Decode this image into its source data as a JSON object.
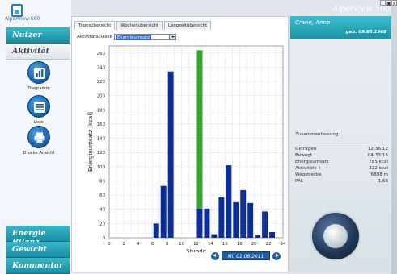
{
  "app": {
    "title": "AlperView 500",
    "logo_text": "AlperView 500",
    "window_controls": [
      "_",
      "▣",
      "x"
    ]
  },
  "sidebar": {
    "nav_top": [
      {
        "label": "Nutzer"
      },
      {
        "label": "Aktivität"
      }
    ],
    "items": [
      {
        "label": "Diagramm",
        "icon": "bar-chart-icon"
      },
      {
        "label": "Liste",
        "icon": "list-icon"
      },
      {
        "label": "Drucke Ansicht",
        "icon": "printer-icon"
      }
    ],
    "nav_bottom": [
      {
        "label": "Energie Bilanz"
      },
      {
        "label": "Gewicht"
      },
      {
        "label": "Kommentar"
      }
    ]
  },
  "main": {
    "tabs": [
      {
        "label": "Tagesübersicht",
        "active": true
      },
      {
        "label": "Wochenübersicht",
        "active": false
      },
      {
        "label": "Langzeitübersicht",
        "active": false
      }
    ],
    "class_label": "Aktivitätsklasse",
    "class_value": "Energieumsatz",
    "date": "Mi, 01.06.2011"
  },
  "user": {
    "name": "Crane, Anne",
    "birth": "geb. 09.05.1968"
  },
  "summary": {
    "title": "Zusammenfassung",
    "rows": [
      {
        "label": "Getragen",
        "value": "12:36:12"
      },
      {
        "label": "Bewegt",
        "value": "04:33:16"
      },
      {
        "label": "Energieumsatz",
        "value": "785 kcal"
      },
      {
        "label": "Aktivität++",
        "value": "222 kcal"
      },
      {
        "label": "Wegstrecke",
        "value": "6898 m"
      },
      {
        "label": "PAL",
        "value": "1,68"
      }
    ]
  },
  "colors": {
    "bar": "#0b2f96",
    "highlight": "#3aa12e",
    "accent": "#1a93a7"
  },
  "chart_data": {
    "type": "bar",
    "xlabel": "Stunde",
    "ylabel": "Energieumsatz [kcal]",
    "xlim": [
      0,
      24
    ],
    "ylim": [
      0,
      270
    ],
    "xticks": [
      0,
      2,
      4,
      6,
      8,
      10,
      12,
      14,
      16,
      18,
      20,
      22,
      24
    ],
    "yticks": [
      0,
      20,
      40,
      60,
      80,
      100,
      120,
      140,
      160,
      180,
      200,
      220,
      240,
      260
    ],
    "grid": true,
    "bars": [
      {
        "x": 6.5,
        "value": 20
      },
      {
        "x": 7.5,
        "value": 73
      },
      {
        "x": 8.5,
        "value": 234
      },
      {
        "x": 12.5,
        "value": 41,
        "highlight_total": 264
      },
      {
        "x": 13.5,
        "value": 41
      },
      {
        "x": 14.5,
        "value": 5
      },
      {
        "x": 15.5,
        "value": 57
      },
      {
        "x": 16.5,
        "value": 102
      },
      {
        "x": 17.5,
        "value": 50
      },
      {
        "x": 18.5,
        "value": 67
      },
      {
        "x": 19.5,
        "value": 49
      },
      {
        "x": 20.5,
        "value": 4
      },
      {
        "x": 21.5,
        "value": 37
      },
      {
        "x": 22.5,
        "value": 8
      }
    ]
  }
}
